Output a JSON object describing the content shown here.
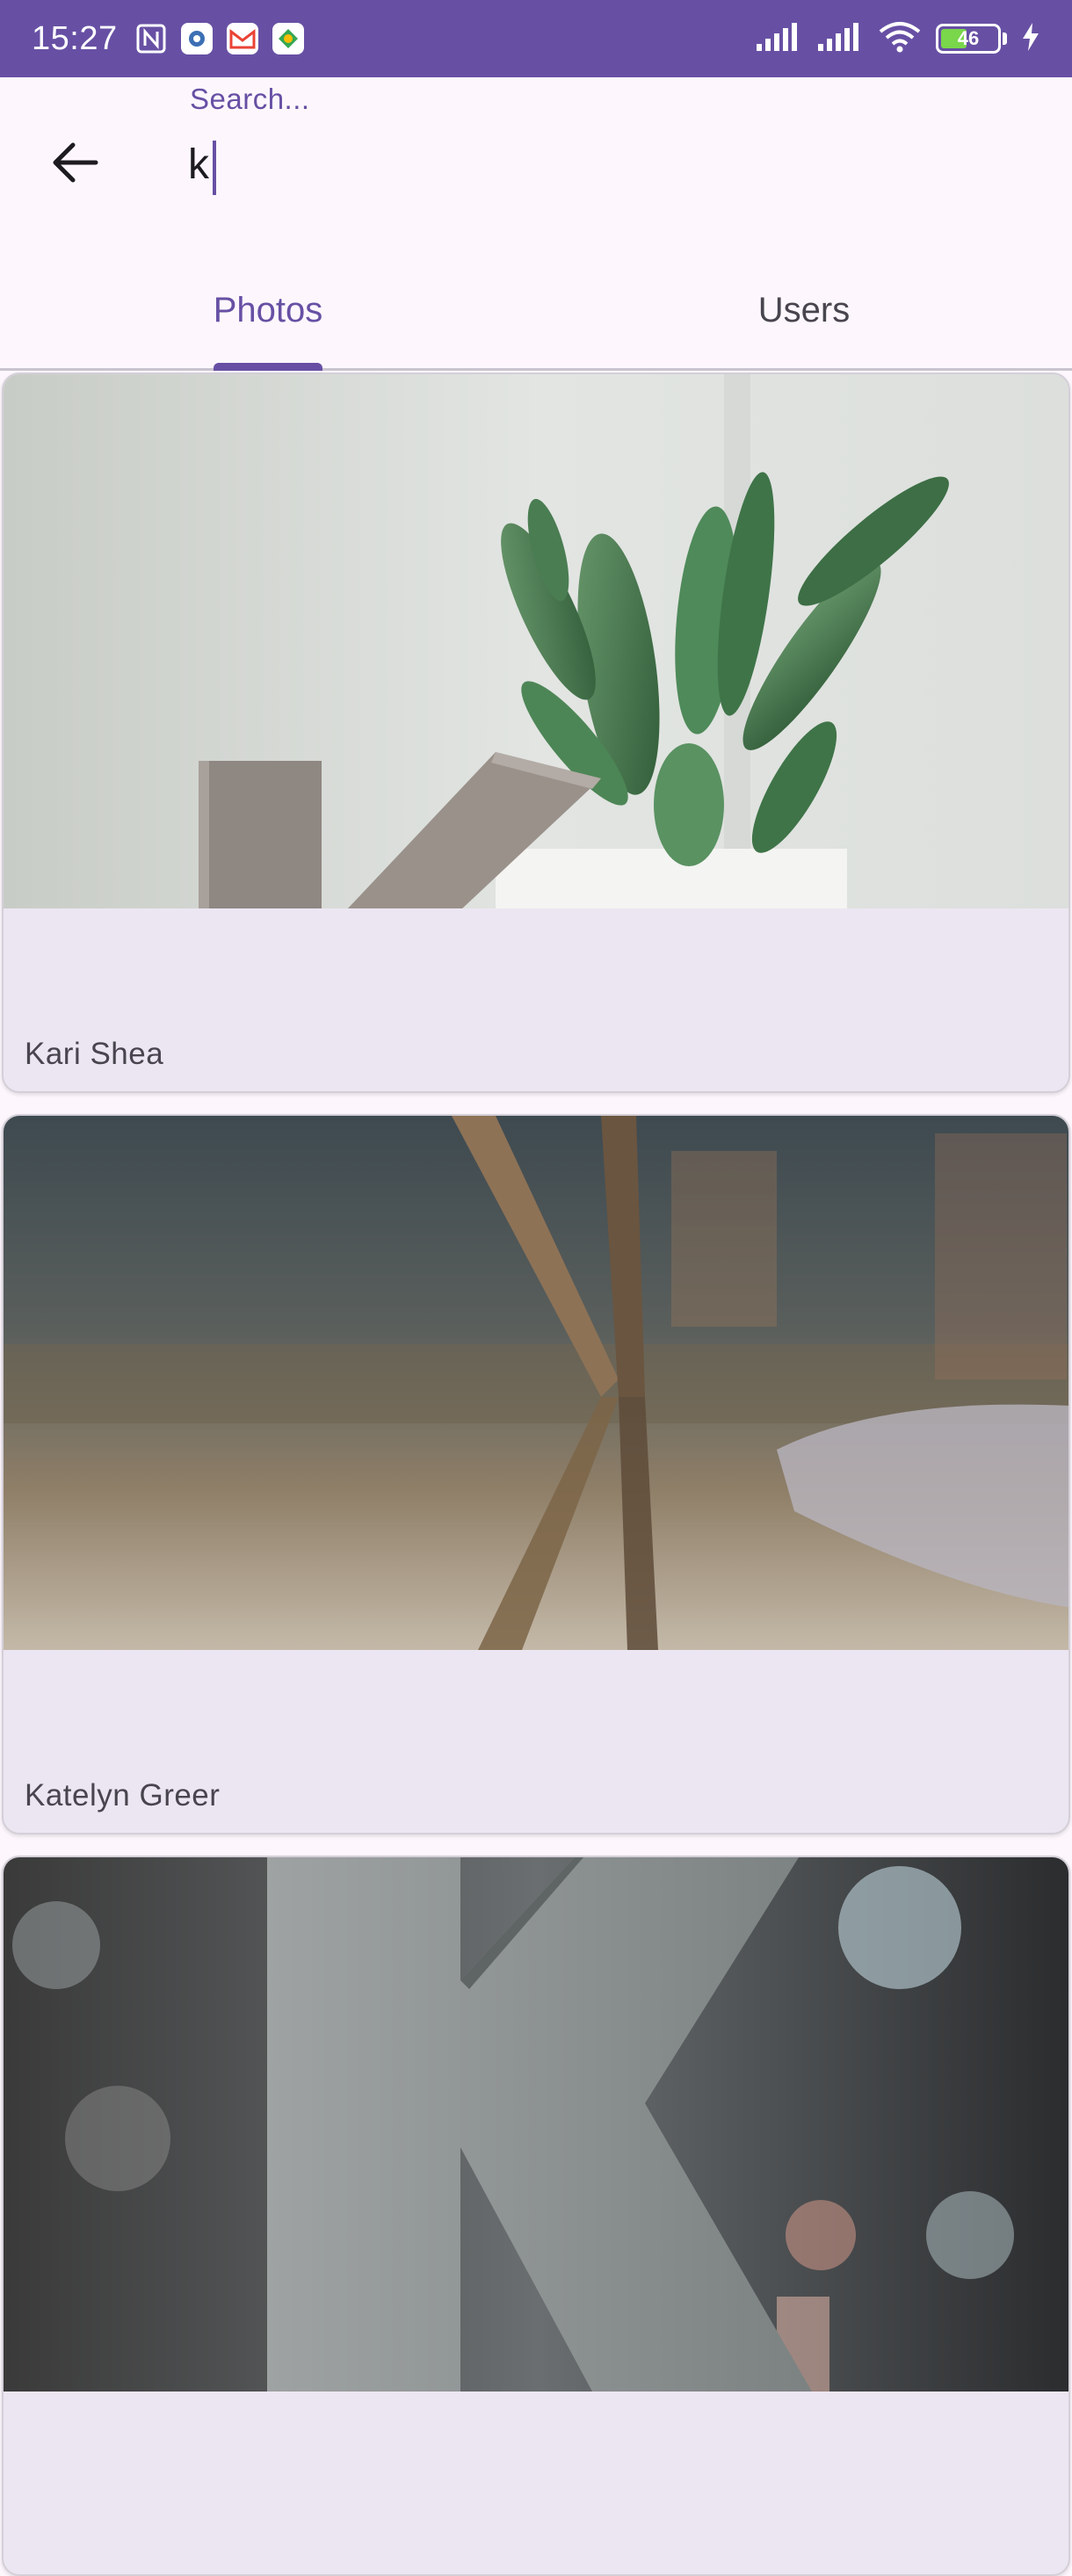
{
  "status": {
    "time": "15:27",
    "battery_level": "46",
    "battery_percent": 46
  },
  "search": {
    "label": "Search...",
    "value": "k"
  },
  "tabs": [
    {
      "label": "Photos",
      "active": true
    },
    {
      "label": "Users",
      "active": false
    }
  ],
  "photos": [
    {
      "author": "Kari Shea"
    },
    {
      "author": "Katelyn Greer"
    },
    {
      "author": ""
    }
  ],
  "colors": {
    "primary": "#6750a4",
    "surface": "#fdf7fd",
    "card": "#ece6f2"
  }
}
